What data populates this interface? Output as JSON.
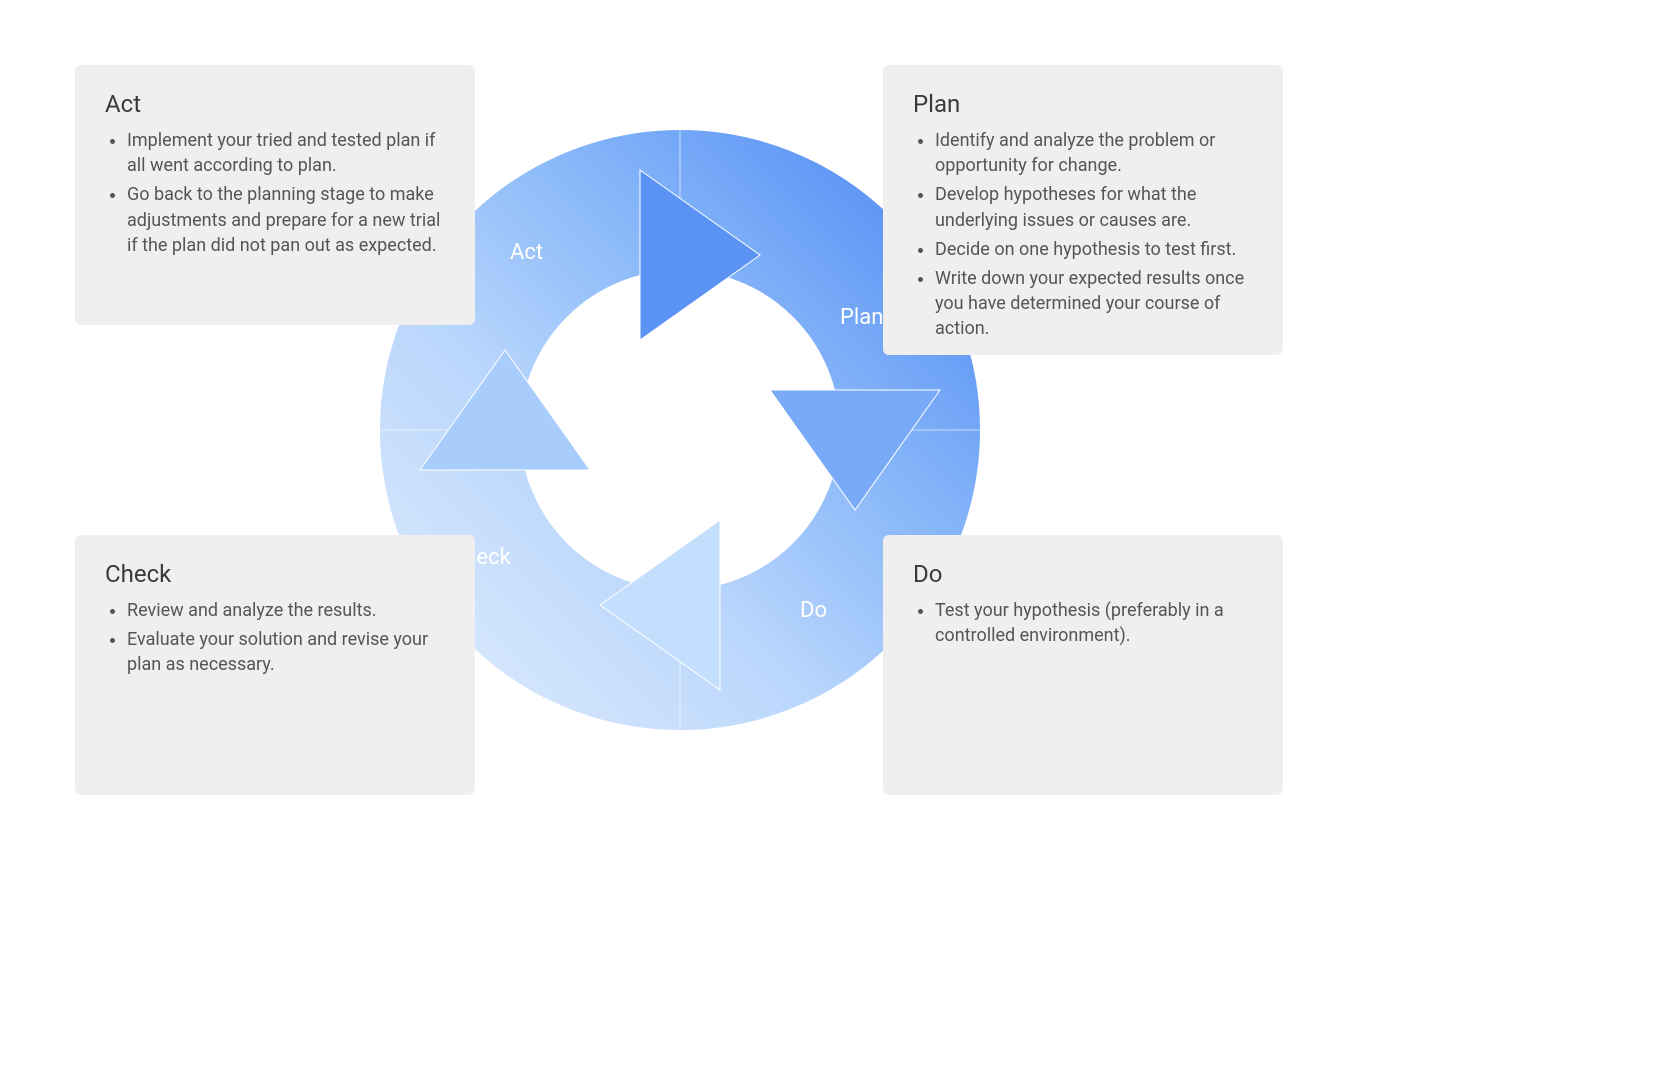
{
  "cycle": {
    "plan_label": "Plan",
    "do_label": "Do",
    "check_label": "Check",
    "act_label": "Act"
  },
  "boxes": {
    "act": {
      "title": "Act",
      "items": [
        "Implement your tried and tested plan if all went according to plan.",
        "Go back to the planning stage to make adjustments and prepare for a new trial if the plan did not pan out as expected."
      ]
    },
    "plan": {
      "title": "Plan",
      "items": [
        "Identify and analyze the problem or opportunity for change.",
        "Develop hypotheses for what the underlying issues or causes are.",
        "Decide on one hypothesis to test first.",
        "Write down your expected results once you have determined your course of action."
      ]
    },
    "check": {
      "title": "Check",
      "items": [
        "Review and analyze the results.",
        "Evaluate your solution and revise your plan as necessary."
      ]
    },
    "do": {
      "title": "Do",
      "items": [
        "Test your hypothesis (preferably in a controlled environment)."
      ]
    }
  }
}
